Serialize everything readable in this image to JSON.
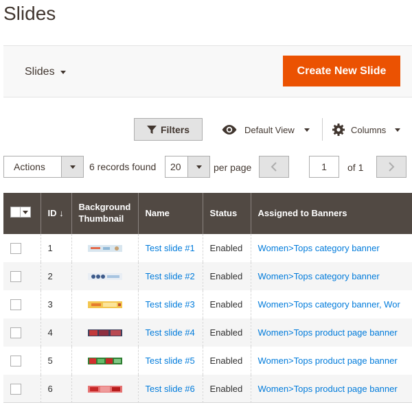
{
  "page": {
    "title": "Slides"
  },
  "header": {
    "switcher_label": "Slides",
    "create_button": "Create New Slide"
  },
  "toolbar": {
    "filters_label": "Filters",
    "view_label": "Default View",
    "columns_label": "Columns",
    "actions_label": "Actions",
    "records_found": "6 records found",
    "per_page_value": "20",
    "per_page_label": "per page",
    "current_page": "1",
    "of_pages": "of 1"
  },
  "grid": {
    "columns": [
      "ID",
      "Background Thumbnail",
      "Name",
      "Status",
      "Assigned to Banners"
    ],
    "sort_indicator": "↓",
    "rows": [
      {
        "id": "1",
        "name": "Test slide #1",
        "status": "Enabled",
        "banners": "Women>Tops category banner",
        "thumb": "thumb-1"
      },
      {
        "id": "2",
        "name": "Test slide #2",
        "status": "Enabled",
        "banners": "Women>Tops category banner",
        "thumb": "thumb-2"
      },
      {
        "id": "3",
        "name": "Test slide #3",
        "status": "Enabled",
        "banners": "Women>Tops category banner, Wor",
        "thumb": "thumb-3"
      },
      {
        "id": "4",
        "name": "Test slide #4",
        "status": "Enabled",
        "banners": "Women>Tops product page banner",
        "thumb": "thumb-4"
      },
      {
        "id": "5",
        "name": "Test slide #5",
        "status": "Enabled",
        "banners": "Women>Tops product page banner",
        "thumb": "thumb-5"
      },
      {
        "id": "6",
        "name": "Test slide #6",
        "status": "Enabled",
        "banners": "Women>Tops product page banner",
        "thumb": "thumb-6"
      }
    ]
  },
  "colors": {
    "accent": "#eb5202",
    "header_bg": "#514943",
    "link": "#007bdb"
  },
  "icons": [
    "caret-down-icon",
    "filter-icon",
    "eye-icon",
    "gear-icon",
    "chevron-left-icon",
    "chevron-right-icon"
  ]
}
